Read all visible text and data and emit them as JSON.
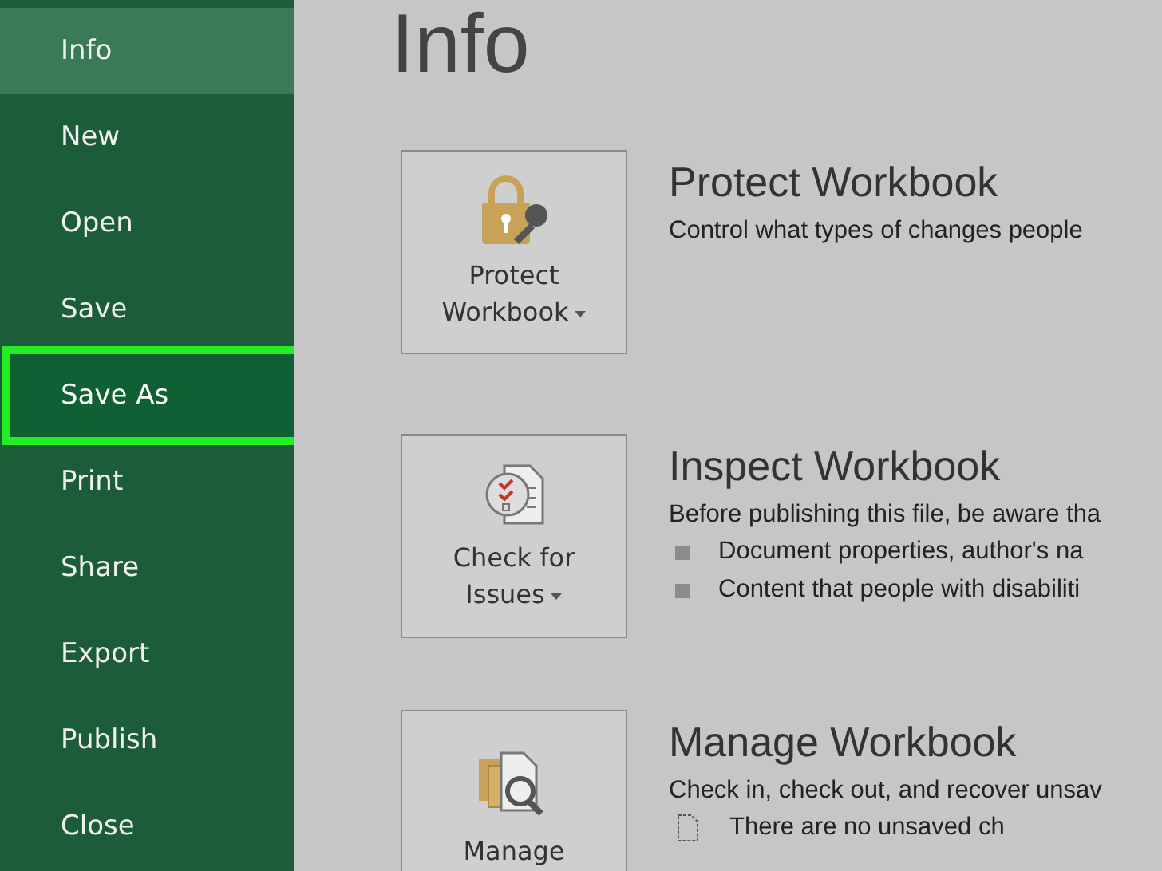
{
  "sidebar": {
    "items": [
      {
        "label": "Info",
        "selected": true,
        "highlighted": false
      },
      {
        "label": "New",
        "selected": false,
        "highlighted": false
      },
      {
        "label": "Open",
        "selected": false,
        "highlighted": false
      },
      {
        "label": "Save",
        "selected": false,
        "highlighted": false
      },
      {
        "label": "Save As",
        "selected": false,
        "highlighted": true
      },
      {
        "label": "Print",
        "selected": false,
        "highlighted": false
      },
      {
        "label": "Share",
        "selected": false,
        "highlighted": false
      },
      {
        "label": "Export",
        "selected": false,
        "highlighted": false
      },
      {
        "label": "Publish",
        "selected": false,
        "highlighted": false
      },
      {
        "label": "Close",
        "selected": false,
        "highlighted": false
      }
    ]
  },
  "page_title": "Info",
  "sections": [
    {
      "kind": "protect",
      "button": {
        "lines": [
          "Protect",
          "Workbook"
        ],
        "dropdown": true
      },
      "heading": "Protect Workbook",
      "description": "Control what types of changes people"
    },
    {
      "kind": "inspect",
      "button": {
        "lines": [
          "Check for",
          "Issues"
        ],
        "dropdown": true
      },
      "heading": "Inspect Workbook",
      "description": "Before publishing this file, be aware tha",
      "bullets": [
        "Document properties, author's na",
        "Content that people with disabiliti"
      ]
    },
    {
      "kind": "manage",
      "button": {
        "lines": [
          "Manage"
        ],
        "dropdown": false
      },
      "heading": "Manage Workbook",
      "description": "Check in, check out, and recover unsav",
      "note": "There are no unsaved ch"
    }
  ]
}
